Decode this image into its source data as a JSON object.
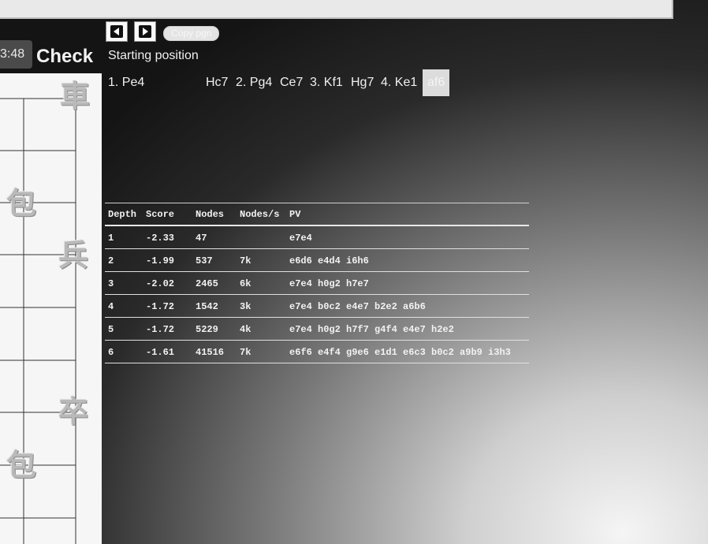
{
  "game": {
    "timer": "3:48",
    "status": "Check",
    "start_label": "Starting position",
    "copy_label": "Copy pgn",
    "moves": [
      {
        "label": "1. Pe4",
        "current": false
      },
      {
        "label": "Hc7",
        "current": false
      },
      {
        "label": "2. Pg4",
        "current": false
      },
      {
        "label": "Ce7",
        "current": false
      },
      {
        "label": "3. Kf1",
        "current": false
      },
      {
        "label": "Hg7",
        "current": false
      },
      {
        "label": "4. Ke1",
        "current": false
      },
      {
        "label": "af6",
        "current": true
      }
    ]
  },
  "board_pieces": [
    "車",
    "包",
    "兵",
    "卒",
    "包"
  ],
  "analysis": {
    "headers": [
      "Depth",
      "Score",
      "Nodes",
      "Nodes/s",
      "PV"
    ],
    "rows": [
      [
        "1",
        "-2.33",
        "47",
        "",
        "e7e4"
      ],
      [
        "2",
        "-1.99",
        "537",
        "7k",
        "e6d6 e4d4 i6h6"
      ],
      [
        "3",
        "-2.02",
        "2465",
        "6k",
        "e7e4 h0g2 h7e7"
      ],
      [
        "4",
        "-1.72",
        "1542",
        "3k",
        "e7e4 b0c2 e4e7 b2e2 a6b6"
      ],
      [
        "5",
        "-1.72",
        "5229",
        "4k",
        "e7e4 h0g2 h7f7 g4f4 e4e7 h2e2"
      ],
      [
        "6",
        "-1.61",
        "41516",
        "7k",
        "e6f6 e4f4 g9e6 e1d1 e6c3 b0c2 a9b9 i3h3"
      ]
    ]
  },
  "icons": {
    "prev": "prev-arrow-icon",
    "next": "next-arrow-icon"
  }
}
